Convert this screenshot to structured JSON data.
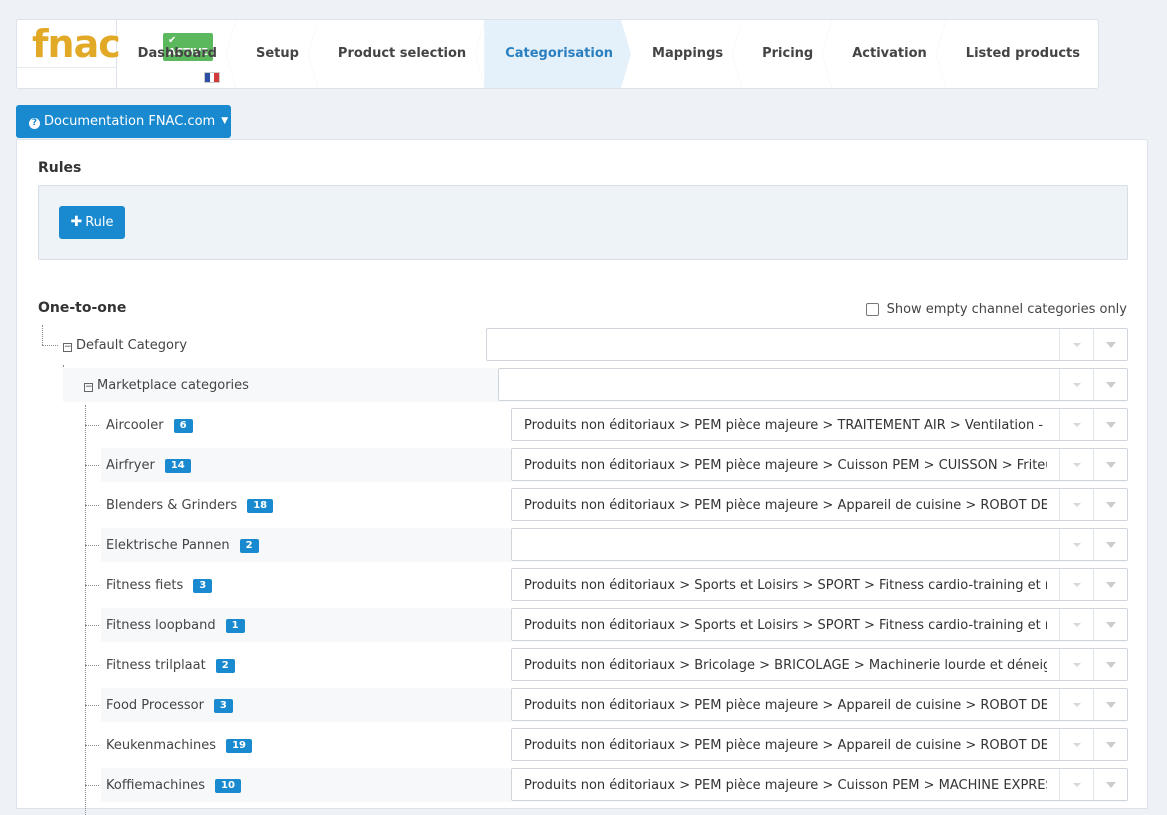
{
  "header": {
    "logo_text": "fnac",
    "status_badge": "ACTIVE",
    "steps": [
      "Dashboard",
      "Setup",
      "Product selection",
      "Categorisation",
      "Mappings",
      "Pricing",
      "Activation",
      "Listed products"
    ],
    "active_step": "Categorisation"
  },
  "docs_button": "Documentation FNAC.com",
  "rules": {
    "title": "Rules",
    "add_rule_label": "Rule"
  },
  "one_to_one": {
    "title": "One-to-one",
    "empty_only_label": "Show empty channel categories only"
  },
  "tree": {
    "root": {
      "label": "Default Category",
      "value": ""
    },
    "marketplace": {
      "label": "Marketplace categories",
      "value": ""
    },
    "items": [
      {
        "label": "Aircooler",
        "count": "6",
        "value": "Produits non éditoriaux > PEM pièce majeure > TRAITEMENT AIR > Ventilation - Chauffage"
      },
      {
        "label": "Airfryer",
        "count": "14",
        "value": "Produits non éditoriaux > PEM pièce majeure > Cuisson PEM > CUISSON > Friteuse"
      },
      {
        "label": "Blenders & Grinders",
        "count": "18",
        "value": "Produits non éditoriaux > PEM pièce majeure > Appareil de cuisine > ROBOT DE CUISINE"
      },
      {
        "label": "Elektrische Pannen",
        "count": "2",
        "value": ""
      },
      {
        "label": "Fitness fiets",
        "count": "3",
        "value": "Produits non éditoriaux > Sports et Loisirs > SPORT > Fitness cardio-training et musculation"
      },
      {
        "label": "Fitness loopband",
        "count": "1",
        "value": "Produits non éditoriaux > Sports et Loisirs > SPORT > Fitness cardio-training et musculation"
      },
      {
        "label": "Fitness trilplaat",
        "count": "2",
        "value": "Produits non éditoriaux > Bricolage > BRICOLAGE > Machinerie lourde et déneigement"
      },
      {
        "label": "Food Processor",
        "count": "3",
        "value": "Produits non éditoriaux > PEM pièce majeure > Appareil de cuisine > ROBOT DE CUISINE"
      },
      {
        "label": "Keukenmachines",
        "count": "19",
        "value": "Produits non éditoriaux > PEM pièce majeure > Appareil de cuisine > ROBOT DE CUISINE"
      },
      {
        "label": "Koffiemachines",
        "count": "10",
        "value": "Produits non éditoriaux > PEM pièce majeure > Cuisson PEM > MACHINE EXPRESSO > Expresso"
      }
    ]
  },
  "colors": {
    "accent": "#1a8ad0",
    "logo": "#e1a925",
    "active_badge": "#5cb85c",
    "active_step_bg": "#e5f1fa"
  },
  "icons": {
    "check": "check-icon",
    "question": "question-circle-icon",
    "plus": "plus-icon",
    "flag": "french-flag-icon"
  }
}
